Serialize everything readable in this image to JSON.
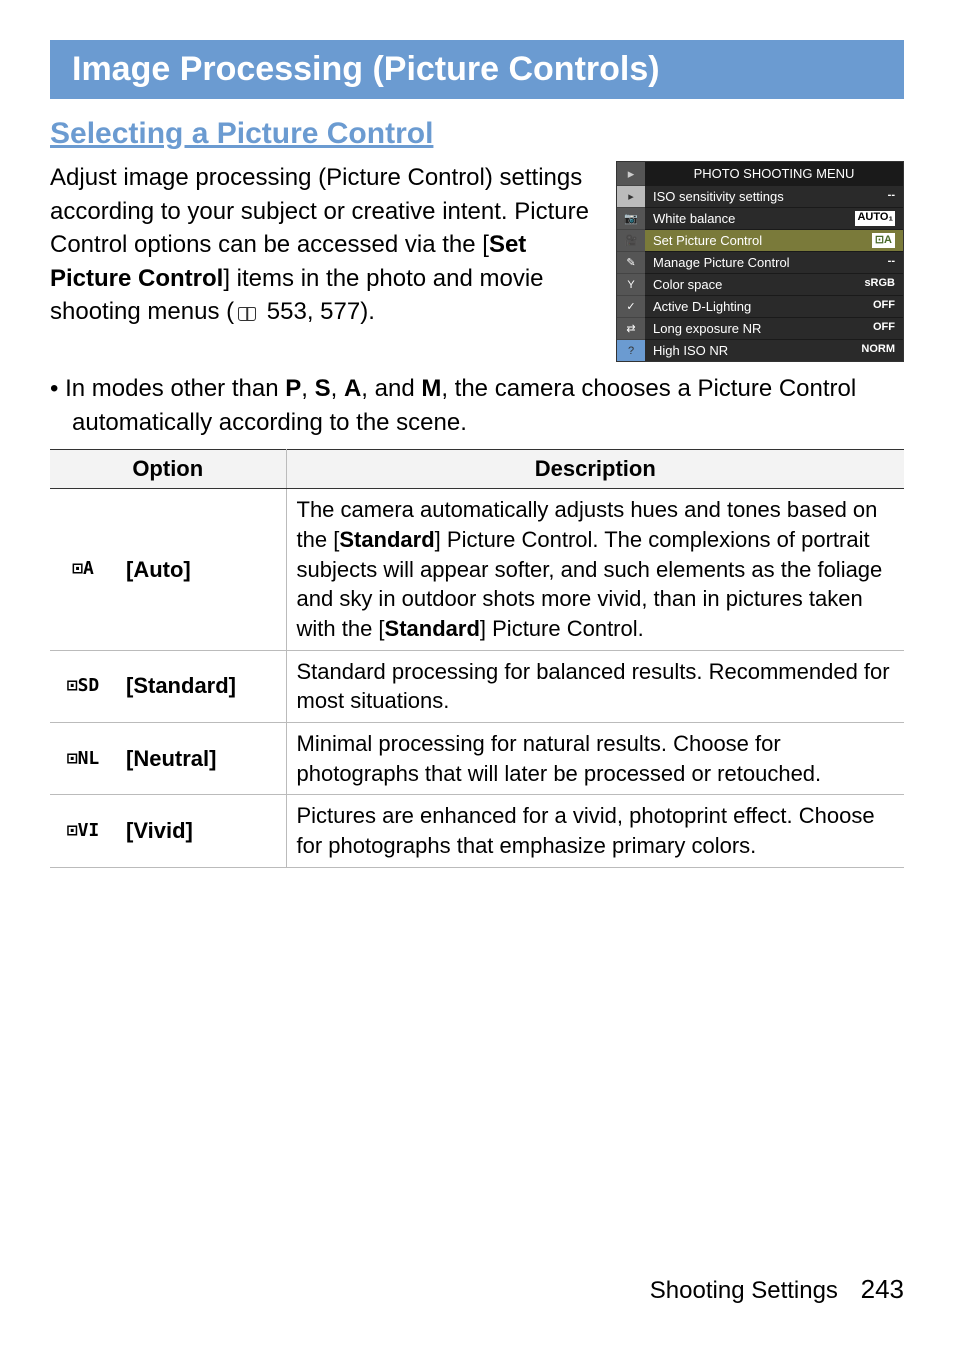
{
  "title": "Image Processing (Picture Controls)",
  "section_heading": "Selecting a Picture Control",
  "intro": {
    "pre": "Adjust image processing (Picture Control) settings according to your subject or creative intent. Picture Control options can be accessed via the [",
    "bold": "Set Picture Control",
    "post": "] items in the photo and movie shooting menus (",
    "refs": " 553, 577)."
  },
  "bullet": {
    "pre": "In modes other than ",
    "m1": "P",
    "s1": ", ",
    "m2": "S",
    "s2": ", ",
    "m3": "A",
    "s3": ", and ",
    "m4": "M",
    "post": ", the camera chooses a Picture Control automatically according to the scene."
  },
  "menu": {
    "title": "PHOTO SHOOTING MENU",
    "items": [
      {
        "icon": "▸",
        "label": "ISO sensitivity settings",
        "value": "--",
        "icon_side": "📷"
      },
      {
        "icon": "📷",
        "label": "White balance",
        "value": "AUTO₁",
        "value_class": "auto-badge"
      },
      {
        "icon": "🎥",
        "label": "Set Picture Control",
        "value": "⊡A",
        "highlighted": true,
        "value_class": "pc-a"
      },
      {
        "icon": "✎",
        "label": "Manage Picture Control",
        "value": "--"
      },
      {
        "icon": "Y",
        "label": "Color space",
        "value": "sRGB"
      },
      {
        "icon": "✓",
        "label": "Active D-Lighting",
        "value": "OFF"
      },
      {
        "icon": "⇄",
        "label": "Long exposure NR",
        "value": "OFF"
      },
      {
        "icon": "?",
        "label": "High ISO NR",
        "value": "NORM",
        "icon_class": "question"
      }
    ]
  },
  "table": {
    "head_option": "Option",
    "head_desc": "Description",
    "rows": [
      {
        "icon": "⊡A",
        "label": "[Auto]",
        "desc_parts": [
          {
            "t": "The camera automatically adjusts hues and tones based on the ["
          },
          {
            "t": "Standard",
            "b": true
          },
          {
            "t": "] Picture Control. The complexions of portrait subjects will appear softer, and such elements as the foliage and sky in outdoor shots more vivid, than in pictures taken with the ["
          },
          {
            "t": "Standard",
            "b": true
          },
          {
            "t": "] Picture Control."
          }
        ]
      },
      {
        "icon": "⊡SD",
        "label": "[Standard]",
        "desc_parts": [
          {
            "t": "Standard processing for balanced results. Recommended for most situations."
          }
        ]
      },
      {
        "icon": "⊡NL",
        "label": "[Neutral]",
        "desc_parts": [
          {
            "t": "Minimal processing for natural results. Choose for photographs that will later be processed or retouched."
          }
        ]
      },
      {
        "icon": "⊡VI",
        "label": "[Vivid]",
        "desc_parts": [
          {
            "t": "Pictures are enhanced for a vivid, photoprint effect. Choose for photographs that emphasize primary colors."
          }
        ]
      }
    ]
  },
  "footer": {
    "section": "Shooting Settings",
    "page": "243"
  }
}
